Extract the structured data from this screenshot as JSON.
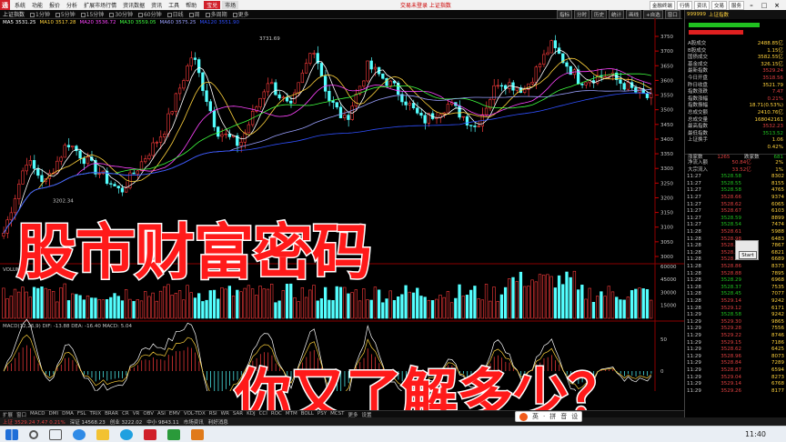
{
  "titlebar": {
    "menu": [
      "系统",
      "功能",
      "报价",
      "分析",
      "扩展市场行情",
      "资讯数据",
      "资讯",
      "工具",
      "帮助"
    ],
    "red_tab": "宝兑",
    "gray_tab": "市场",
    "center_text": "交易未登录 上证指数",
    "right_buttons": [
      "金融终端",
      "行情",
      "资讯",
      "交易",
      "服务"
    ]
  },
  "toolbar": {
    "stock": "上证指数",
    "items": [
      "1分钟",
      "5分钟",
      "15分钟",
      "30分钟",
      "60分钟",
      "日线",
      "周",
      "多周期",
      "更多"
    ],
    "tools": [
      "指标",
      "分时",
      "历史",
      "统计",
      "画线",
      "+自选",
      "窗口"
    ]
  },
  "legend": {
    "ma5": "MA5 3531.25",
    "ma10": "MA10 3517.28",
    "ma20": "MA20 3536.72",
    "ma30": "MA30 3559.05",
    "ma60": "MA60 3575.25",
    "ma120": "MA120 3551.90",
    "colors": {
      "ma5": "#ffffff",
      "ma10": "#ffd23c",
      "ma20": "#ff44ff",
      "ma30": "#40ff40",
      "ma60": "#9aa0ff",
      "ma120": "#3050ff"
    }
  },
  "chart_data": {
    "type": "candlestick",
    "price_ticks": [
      "3750",
      "3700",
      "3650",
      "3600",
      "3550",
      "3500",
      "3450",
      "3400",
      "3350",
      "3300",
      "3250",
      "3200",
      "3150",
      "3100",
      "3050",
      "3000"
    ],
    "high_label": "3731.69",
    "low_label": "3202.34",
    "vol_label": "VOLUME",
    "vol_ticks": [
      "60000",
      "45000",
      "30000",
      "15000"
    ],
    "macd_label": "MACD(12,26,9) DIF: -13.88 DEA: -16.40 MACD: 5.04",
    "macd_ticks": [
      "50",
      "0",
      "-50"
    ],
    "x_labels": [
      "2020年",
      "9",
      "10",
      "11",
      "12",
      "2021",
      "2",
      "3",
      "4",
      "5",
      "6",
      "7",
      "8",
      "9",
      "10",
      "11"
    ]
  },
  "overlay": {
    "line1": "股市财富密码",
    "line2": "你又了解多少？"
  },
  "bottom_tabs": [
    "扩展",
    "窗口",
    "MACD",
    "DMI",
    "DMA",
    "FSL",
    "TRIX",
    "BRAR",
    "CR",
    "VR",
    "OBV",
    "ASI",
    "EMV",
    "VOL-TDX",
    "RSI",
    "WR",
    "SAR",
    "KDJ",
    "CCI",
    "ROC",
    "MTM",
    "BOLL",
    "PSY",
    "MCST",
    "更多",
    "设置"
  ],
  "status": [
    "上证 3529.24 7.47 0.21%",
    "深证 14568.23",
    "创业 3222.02",
    "中小 9843.11",
    "市场资讯",
    "利好消息"
  ],
  "rpanel": {
    "code": "999999",
    "name": "上证指数",
    "rows": [
      {
        "l": "A股成交",
        "v": "2488.85亿",
        "c": "y"
      },
      {
        "l": "B股成交",
        "v": "1.15亿",
        "c": "y"
      },
      {
        "l": "国债成交",
        "v": "3582.55亿",
        "c": "y"
      },
      {
        "l": "基金成交",
        "v": "326.15亿",
        "c": "y"
      },
      {
        "l": "最新指数",
        "v": "3529.24",
        "c": ""
      },
      {
        "l": "今日开盘",
        "v": "3518.56",
        "c": ""
      },
      {
        "l": "昨日收盘",
        "v": "3521.79",
        "c": "y"
      },
      {
        "l": "指数涨跌",
        "v": "7.47",
        "c": ""
      },
      {
        "l": "指数涨幅",
        "v": "0.21%",
        "c": ""
      },
      {
        "l": "指数振幅",
        "v": "18.71(0.53%)",
        "c": "y"
      },
      {
        "l": "总成交额",
        "v": "2410.76亿",
        "c": "y"
      },
      {
        "l": "总成交量",
        "v": "168042161",
        "c": "y"
      },
      {
        "l": "最高指数",
        "v": "3532.23",
        "c": ""
      },
      {
        "l": "最低指数",
        "v": "3513.52",
        "c": "g"
      },
      {
        "l": "上证换手",
        "v": "1.06",
        "c": "y"
      },
      {
        "l": "",
        "v": "0.42%",
        "c": "y"
      }
    ],
    "updown": {
      "l": "涨家数",
      "v": "1265",
      "l2": "跌家数",
      "v2": "681"
    },
    "flow": [
      {
        "l": "净流入额",
        "v": "50.84亿",
        "p": "2%"
      },
      {
        "l": "大宗流入",
        "v": "33.52亿",
        "p": "1%"
      }
    ],
    "ticks": [
      [
        "11:27",
        "3528.58",
        "8302"
      ],
      [
        "11:27",
        "3528.55",
        "8155"
      ],
      [
        "11:27",
        "3528.58",
        "4765"
      ],
      [
        "11:27",
        "3528.66",
        "9374"
      ],
      [
        "11:27",
        "3528.62",
        "6065"
      ],
      [
        "11:27",
        "3528.67",
        "6103"
      ],
      [
        "11:27",
        "3528.59",
        "8899"
      ],
      [
        "11:27",
        "3528.54",
        "7474"
      ],
      [
        "11:28",
        "3528.61",
        "5988"
      ],
      [
        "11:28",
        "3528.98",
        "6483"
      ],
      [
        "11:28",
        "3528.93",
        "7867"
      ],
      [
        "11:28",
        "3528.74",
        "6821"
      ],
      [
        "11:28",
        "3528.85",
        "6689"
      ],
      [
        "11:28",
        "3528.86",
        "8373"
      ],
      [
        "11:28",
        "3528.88",
        "7895"
      ],
      [
        "11:28",
        "3528.29",
        "6968"
      ],
      [
        "11:28",
        "3528.37",
        "7535"
      ],
      [
        "11:28",
        "3528.45",
        "7077"
      ],
      [
        "11:28",
        "3529.14",
        "9242"
      ],
      [
        "11:28",
        "3529.12",
        "6171"
      ],
      [
        "11:29",
        "3528.58",
        "9242"
      ],
      [
        "11:29",
        "3529.30",
        "9865"
      ],
      [
        "11:29",
        "3529.28",
        "7556"
      ],
      [
        "11:29",
        "3529.22",
        "8746"
      ],
      [
        "11:29",
        "3529.15",
        "7186"
      ],
      [
        "11:29",
        "3528.62",
        "6425"
      ],
      [
        "11:29",
        "3528.96",
        "8073"
      ],
      [
        "11:29",
        "3528.84",
        "7289"
      ],
      [
        "11:29",
        "3528.87",
        "6594"
      ],
      [
        "11:29",
        "3529.04",
        "8273"
      ],
      [
        "11:29",
        "3529.14",
        "6768"
      ],
      [
        "11:29",
        "3529.26",
        "8177"
      ]
    ],
    "popup_btn": "Start"
  },
  "ime": [
    "英",
    "·",
    "拼",
    "音",
    "设"
  ],
  "clock": "11:40"
}
